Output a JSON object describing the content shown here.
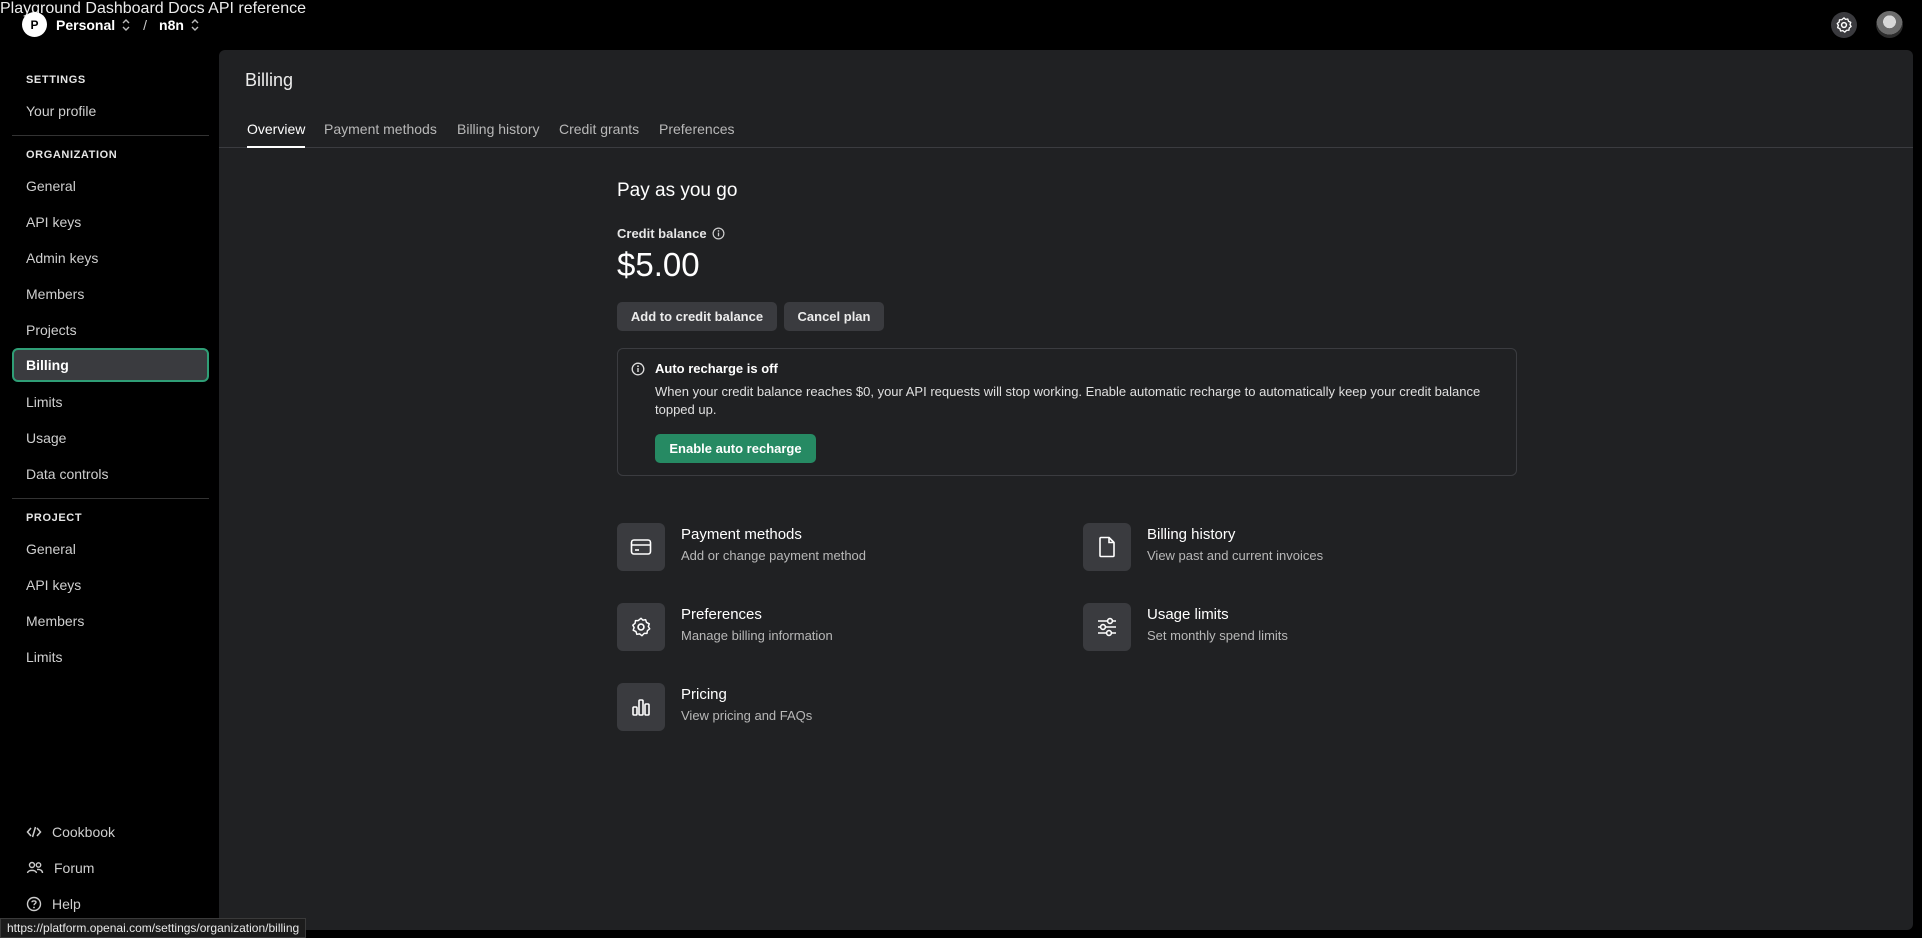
{
  "topbar": {
    "org_initial": "P",
    "org_name": "Personal",
    "separator": "/",
    "project_name": "n8n",
    "nav": [
      "Playground",
      "Dashboard",
      "Docs",
      "API reference"
    ]
  },
  "sidebar": {
    "settings_title": "SETTINGS",
    "settings_items": [
      "Your profile"
    ],
    "organization_title": "ORGANIZATION",
    "organization_items": [
      "General",
      "API keys",
      "Admin keys",
      "Members",
      "Projects",
      "Billing",
      "Limits",
      "Usage",
      "Data controls"
    ],
    "active_item": "Billing",
    "project_title": "PROJECT",
    "project_items": [
      "General",
      "API keys",
      "Members",
      "Limits"
    ],
    "footer": [
      {
        "label": "Cookbook",
        "icon": "code-icon"
      },
      {
        "label": "Forum",
        "icon": "people-icon"
      },
      {
        "label": "Help",
        "icon": "help-icon"
      }
    ]
  },
  "main": {
    "title": "Billing",
    "tabs": [
      "Overview",
      "Payment methods",
      "Billing history",
      "Credit grants",
      "Preferences"
    ],
    "active_tab": "Overview",
    "plan_title": "Pay as you go",
    "credit_label": "Credit balance",
    "credit_balance": "$5.00",
    "add_credit_button": "Add to credit balance",
    "cancel_plan_button": "Cancel plan",
    "recharge": {
      "title": "Auto recharge is off",
      "description": "When your credit balance reaches $0, your API requests will stop working. Enable automatic recharge to automatically keep your credit balance topped up.",
      "button": "Enable auto recharge"
    },
    "cards": [
      {
        "title": "Payment methods",
        "subtitle": "Add or change payment method",
        "icon": "credit-card-icon"
      },
      {
        "title": "Billing history",
        "subtitle": "View past and current invoices",
        "icon": "document-icon"
      },
      {
        "title": "Preferences",
        "subtitle": "Manage billing information",
        "icon": "gear-icon"
      },
      {
        "title": "Usage limits",
        "subtitle": "Set monthly spend limits",
        "icon": "sliders-icon"
      },
      {
        "title": "Pricing",
        "subtitle": "View pricing and FAQs",
        "icon": "chart-icon"
      }
    ]
  },
  "status_url": "https://platform.openai.com/settings/organization/billing",
  "colors": {
    "accent_green": "#268a63",
    "active_border": "#2f9e76",
    "panel_bg": "#202123"
  }
}
